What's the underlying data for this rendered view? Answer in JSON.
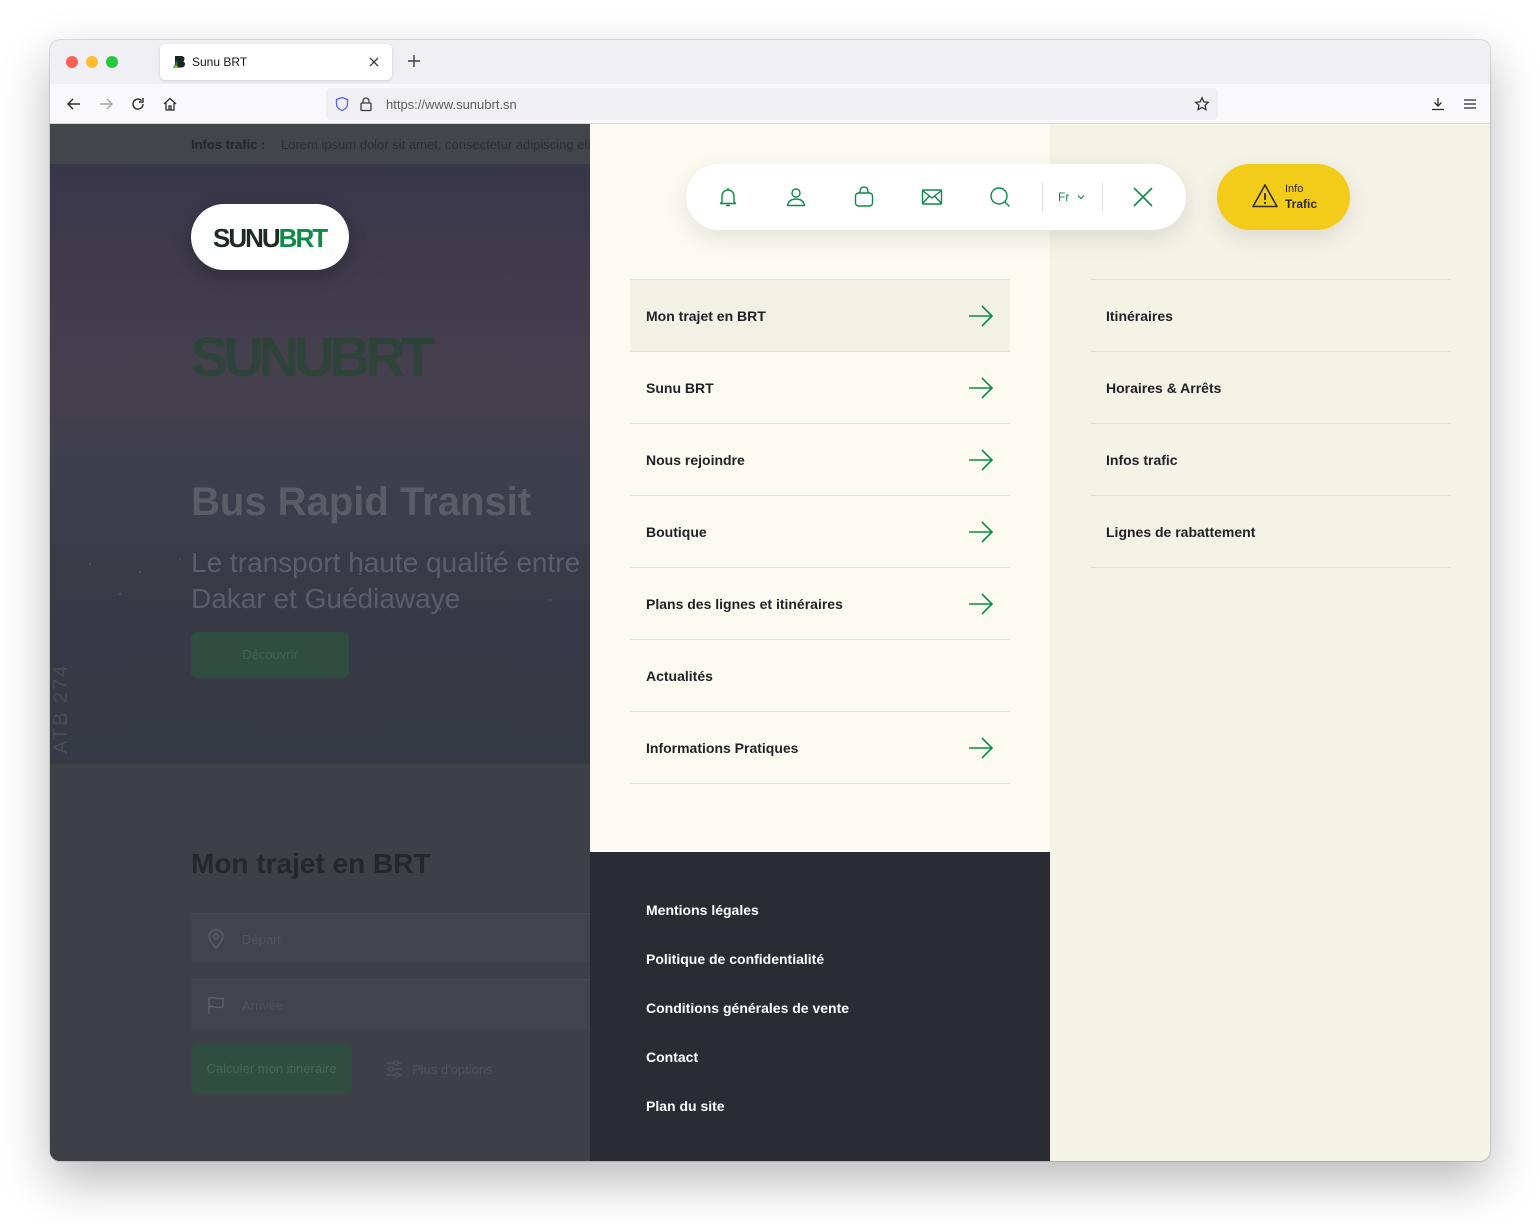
{
  "browser": {
    "tab_title": "Sunu BRT",
    "url": "https://www.sunubrt.sn"
  },
  "infobar": {
    "label": "Infos trafic :",
    "text": "Lorem ipsum dolor sit amet, consectetur adipiscing elit"
  },
  "logo": {
    "part1": "SUNU",
    "part2": "BRT"
  },
  "hero": {
    "title": "Bus Rapid Transit",
    "subtitle": "Le transport haute qualité entre Dakar et Guédiawaye",
    "button": "Découvrir",
    "vertical_text": "ATB 274"
  },
  "trip": {
    "title": "Mon trajet en BRT",
    "depart_placeholder": "Départ",
    "arrivee_placeholder": "Arrivée",
    "calc_button": "Calculer mon itinéraire",
    "more_options": "Plus d'options"
  },
  "toolbar": {
    "lang": "Fr",
    "icons": [
      "bell-icon",
      "user-icon",
      "basket-icon",
      "mail-icon",
      "search-icon",
      "close-icon"
    ]
  },
  "info_trafic": {
    "line1": "Info",
    "line2": "Trafic"
  },
  "main_menu": [
    {
      "label": "Mon trajet en BRT",
      "arrow": true
    },
    {
      "label": "Sunu BRT",
      "arrow": true
    },
    {
      "label": "Nous rejoindre",
      "arrow": true
    },
    {
      "label": "Boutique",
      "arrow": true
    },
    {
      "label": "Plans des lignes et itinéraires",
      "arrow": true
    },
    {
      "label": "Actualités",
      "arrow": false
    },
    {
      "label": "Informations Pratiques",
      "arrow": true
    }
  ],
  "secondary_menu": [
    {
      "label": "Itinéraires"
    },
    {
      "label": "Horaires & Arrêts"
    },
    {
      "label": "Infos trafic"
    },
    {
      "label": "Lignes de rabattement"
    }
  ],
  "footer_menu": [
    {
      "label": "Mentions légales"
    },
    {
      "label": "Politique de confidentialité"
    },
    {
      "label": "Conditions générales de vente"
    },
    {
      "label": "Contact"
    },
    {
      "label": "Plan du site"
    }
  ],
  "colors": {
    "brand_green": "#0e8a47",
    "accent_yellow": "#f2cc18",
    "footer_dark": "#292c33",
    "menu_bg": "#fdfbf1",
    "secondary_bg": "#f5f2e6"
  }
}
